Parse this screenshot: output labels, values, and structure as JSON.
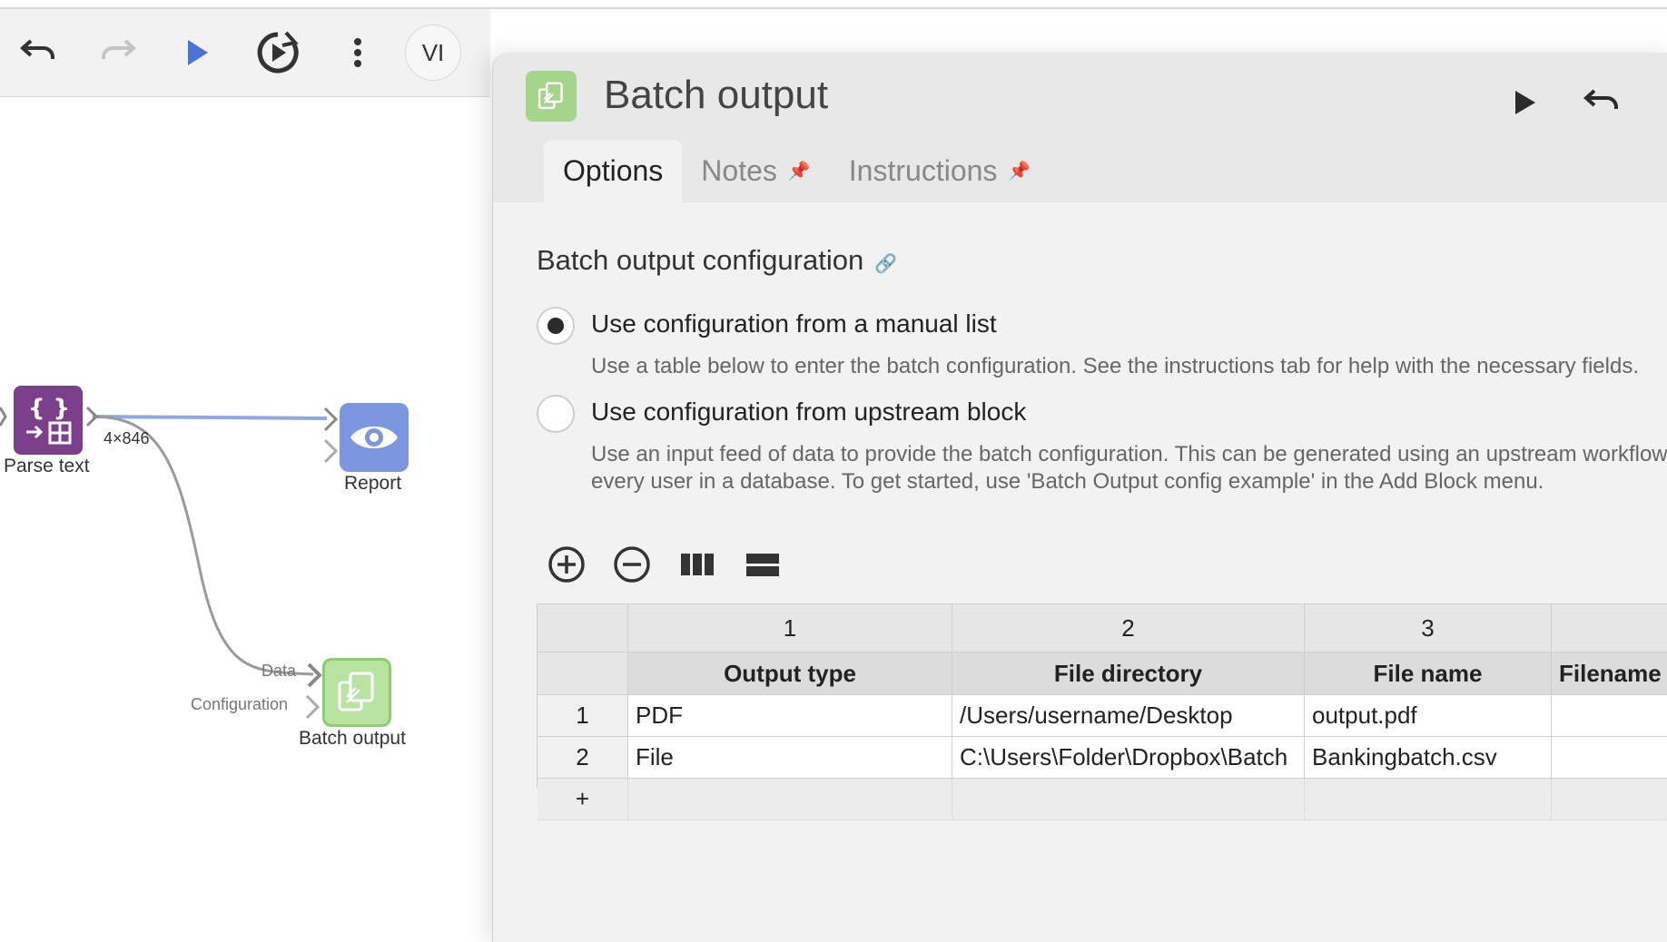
{
  "toolbar": {
    "undo": "undo-icon",
    "redo": "redo-icon",
    "run": "play-icon",
    "rerun": "rerun-icon",
    "more": "kebab-icon",
    "user_initials": "VI"
  },
  "canvas": {
    "nodes": [
      {
        "id": "parse-text",
        "label": "Parse text",
        "icon": "parse-icon",
        "color": "#7b3f8c"
      },
      {
        "id": "report",
        "label": "Report",
        "icon": "eye-icon",
        "color": "#7c97e0"
      },
      {
        "id": "batch-output",
        "label": "Batch output",
        "icon": "documents-icon",
        "color": "#b9e3a1"
      }
    ],
    "edge_label": "4×846",
    "ports": {
      "data": "Data",
      "configuration": "Configuration"
    }
  },
  "panel": {
    "title": "Batch output",
    "tabs": [
      {
        "label": "Options",
        "active": true
      },
      {
        "label": "Notes",
        "pinned": true
      },
      {
        "label": "Instructions",
        "pinned": true
      }
    ],
    "section_title": "Batch output configuration",
    "options": [
      {
        "label": "Use configuration from a manual list",
        "checked": true,
        "desc": [
          "Use a table below to enter the batch configuration. See the instructions tab for help with the necessary fields."
        ]
      },
      {
        "label": "Use configuration from upstream block",
        "checked": false,
        "desc": [
          "Use an input feed of data to provide the batch configuration. This can be generated using an upstream workflow, such as",
          "every user in a database. To get started, use 'Batch Output config example' in the Add Block menu."
        ]
      }
    ],
    "table_tools": [
      "add-circle-icon",
      "remove-circle-icon",
      "columns-icon",
      "rows-icon"
    ],
    "table": {
      "col_numbers": [
        "1",
        "2",
        "3",
        ""
      ],
      "columns": [
        "Output type",
        "File directory",
        "File name",
        "Filename"
      ],
      "rows": [
        {
          "num": "1",
          "cells": [
            "PDF",
            "/Users/username/Desktop",
            "output.pdf",
            ""
          ]
        },
        {
          "num": "2",
          "cells": [
            "File",
            "C:\\Users\\Folder\\Dropbox\\Batch",
            "Bankingbatch.csv",
            ""
          ]
        }
      ],
      "add_row": "+"
    }
  }
}
